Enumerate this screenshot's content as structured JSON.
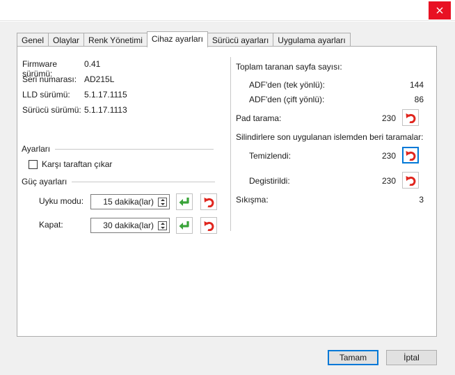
{
  "window": {
    "close_icon": "close-icon"
  },
  "tabs": [
    {
      "label": "Genel"
    },
    {
      "label": "Olaylar"
    },
    {
      "label": "Renk Yönetimi"
    },
    {
      "label": "Cihaz ayarları"
    },
    {
      "label": "Sürücü ayarları"
    },
    {
      "label": "Uygulama ayarları"
    }
  ],
  "device_info": {
    "firmware_label": "Firmware sürümü:",
    "firmware_value": "0.41",
    "serial_label": "Seri numarası:",
    "serial_value": "AD215L",
    "lld_label": "LLD sürümü:",
    "lld_value": "5.1.17.1115",
    "driver_label": "Sürücü sürümü:",
    "driver_value": "5.1.17.1113"
  },
  "settings": {
    "group_label": "Ayarları",
    "eject_label": "Karşı taraftan çıkar",
    "eject_checked": false
  },
  "power": {
    "group_label": "Güç ayarları",
    "sleep_label": "Uyku modu:",
    "sleep_value": "15 dakika(lar)",
    "off_label": "Kapat:",
    "off_value": "30 dakika(lar)"
  },
  "counters": {
    "total_label": "Toplam taranan sayfa sayısı:",
    "adf_simplex_label": "ADF'den (tek yönlü):",
    "adf_simplex_value": "144",
    "adf_duplex_label": "ADF'den (çift yönlü):",
    "adf_duplex_value": "86",
    "pad_label": "Pad tarama:",
    "pad_value": "230",
    "roller_label": "Silindirlere son uygulanan islemden beri taramalar:",
    "cleaned_label": "Temizlendi:",
    "cleaned_value": "230",
    "replaced_label": "Degistirildi:",
    "replaced_value": "230",
    "jam_label": "Sıkışma:",
    "jam_value": "3"
  },
  "footer": {
    "ok_label": "Tamam",
    "cancel_label": "İptal"
  },
  "colors": {
    "close_red": "#e81123",
    "apply_green": "#3aa43a",
    "reset_red": "#e0261e",
    "focus_blue": "#0078d7"
  }
}
